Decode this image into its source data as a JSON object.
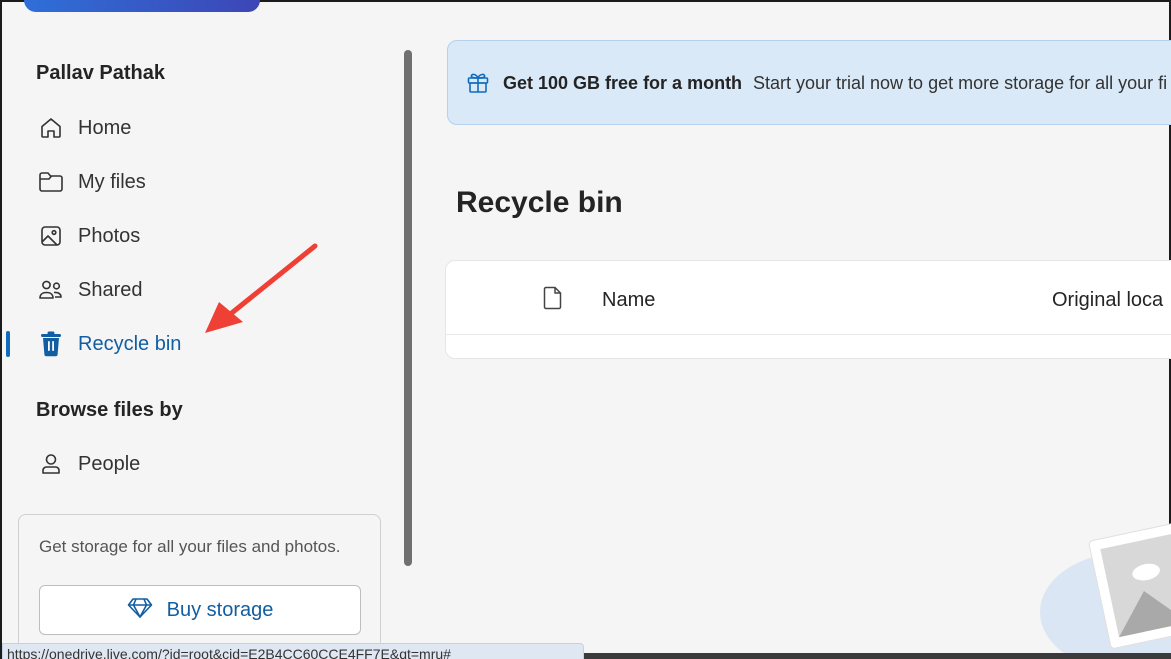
{
  "sidebar": {
    "user_name": "Pallav Pathak",
    "nav": [
      {
        "label": "Home",
        "icon": "home-icon"
      },
      {
        "label": "My files",
        "icon": "folder-icon"
      },
      {
        "label": "Photos",
        "icon": "photo-icon"
      },
      {
        "label": "Shared",
        "icon": "people-icon"
      },
      {
        "label": "Recycle bin",
        "icon": "trash-icon",
        "active": true
      }
    ],
    "browse_title": "Browse files by",
    "browse": [
      {
        "label": "People",
        "icon": "person-icon"
      }
    ],
    "storage_card": {
      "text": "Get storage for all your files and photos.",
      "button_label": "Buy storage",
      "button_icon": "diamond-icon"
    }
  },
  "promo": {
    "icon": "gift-icon",
    "title": "Get 100 GB free for a month",
    "description": "Start your trial now to get more storage for all your fi"
  },
  "main": {
    "page_title": "Recycle bin",
    "table": {
      "columns": [
        "Name",
        "Original loca"
      ]
    }
  },
  "status_bar": {
    "url": "https://onedrive.live.com/?id=root&cid=E2B4CC60CCE4FF7E&qt=mru#"
  },
  "colors": {
    "accent": "#0f6cbd",
    "active_text": "#115ea3",
    "promo_bg": "#d9e9f8",
    "annotation": "#ee4035"
  }
}
